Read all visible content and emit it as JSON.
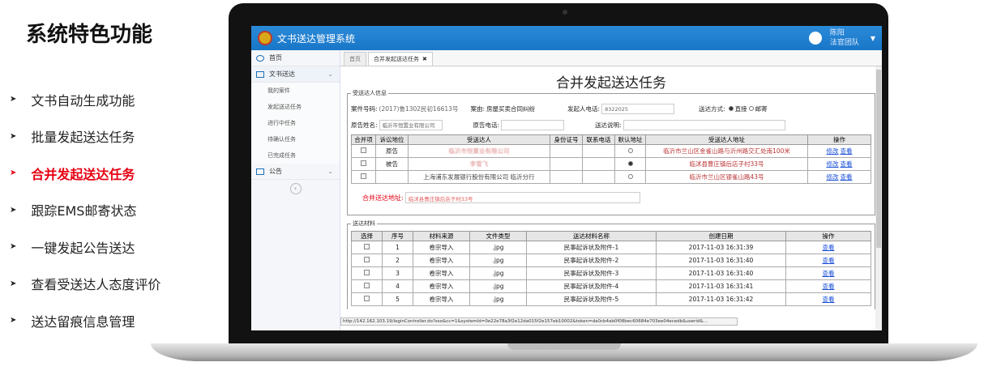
{
  "features": {
    "title": "系统特色功能",
    "items": [
      {
        "label": "文书自动生成功能",
        "active": false
      },
      {
        "label": "批量发起送达任务",
        "active": false
      },
      {
        "label": "合并发起送达任务",
        "active": true
      },
      {
        "label": "跟踪EMS邮寄状态",
        "active": false
      },
      {
        "label": "一键发起公告送达",
        "active": false
      },
      {
        "label": "查看受送达人态度评价",
        "active": false
      },
      {
        "label": "送达留痕信息管理",
        "active": false
      }
    ]
  },
  "app": {
    "title": "文书送达管理系统",
    "user": {
      "name": "陈阳",
      "role": "法官团队"
    }
  },
  "sidebar": {
    "home": "首页",
    "delivery": "文书送达",
    "sub": [
      "我的案件",
      "发起送达任务",
      "进行中任务",
      "待确认任务",
      "已完成任务"
    ],
    "notice": "公告"
  },
  "tabs": {
    "home": "首页",
    "active": "合并发起送达任务"
  },
  "form": {
    "title": "合并发起送达任务",
    "recipient_legend": "受送达人信息",
    "case_no_label": "案件号码:",
    "case_no": "(2017)鲁1302民初16613号",
    "cause_label": "案由:",
    "cause": "房屋买卖合同纠纷",
    "initiator_phone_label": "发起人电话:",
    "initiator_phone": "8322025",
    "method_label": "送达方式:",
    "method_direct": "直接",
    "method_mail": "邮寄",
    "plaintiff_name_label": "原告姓名:",
    "plaintiff_name": "临沂市恒置业有限公司",
    "plaintiff_phone_label": "原告电话:",
    "note_label": "送达说明:"
  },
  "recipients": {
    "headers": [
      "合并项",
      "诉讼地位",
      "受送达人",
      "身份证号",
      "联系电话",
      "默认地址",
      "受送达人地址",
      "操作"
    ],
    "rows": [
      {
        "status": "原告",
        "name": "临沂市恒置业有限公司",
        "addr": "临沂市兰山区金雀山路与沂州路交汇处南100米",
        "def": false
      },
      {
        "status": "被告",
        "name": "李雪飞",
        "addr": "临沭县曹庄镇后店子村33号",
        "def": true
      },
      {
        "status": "",
        "name": "上海浦东发展银行股份有限公司 临沂分行",
        "addr": "临沂市兰山区银雀山路43号",
        "def": false
      }
    ],
    "edit": "修改",
    "view": "查看"
  },
  "merge": {
    "label": "合并送达地址:",
    "value": "临沭县曹庄镇后店子村33号"
  },
  "materials": {
    "legend": "送达材料",
    "headers": [
      "选择",
      "序号",
      "材料来源",
      "文件类型",
      "送达材料名称",
      "创建日期",
      "操作"
    ],
    "rows": [
      {
        "no": "1",
        "src": "卷宗导入",
        "type": ".jpg",
        "name": "民事起诉状及附件-1",
        "date": "2017-11-03 16:31:39"
      },
      {
        "no": "2",
        "src": "卷宗导入",
        "type": ".jpg",
        "name": "民事起诉状及附件-2",
        "date": "2017-11-03 16:31:40"
      },
      {
        "no": "3",
        "src": "卷宗导入",
        "type": ".jpg",
        "name": "民事起诉状及附件-3",
        "date": "2017-11-03 16:31:40"
      },
      {
        "no": "4",
        "src": "卷宗导入",
        "type": ".jpg",
        "name": "民事起诉状及附件-4",
        "date": "2017-11-03 16:31:41"
      },
      {
        "no": "5",
        "src": "卷宗导入",
        "type": ".jpg",
        "name": "民事起诉状及附件-5",
        "date": "2017-11-03 16:31:42"
      }
    ],
    "view": "查看"
  },
  "statusbar": "http://142.162.103.19/loginController.do?sso&cc=1&systemId=0e22e78a3f2e12da015f2e157eb10002&token=da0cb4ab0f08bec60684e703ee04ecedb&userid&..."
}
